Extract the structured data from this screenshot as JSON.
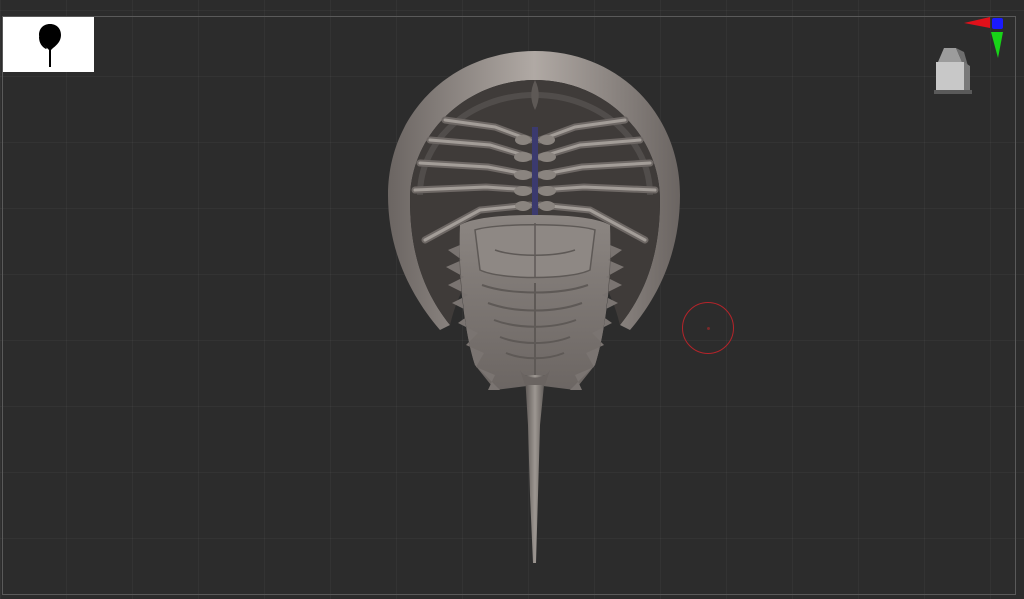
{
  "app": {
    "viewport_background": "#2c2c2c",
    "grid_color": "rgba(255,255,255,0.035)",
    "frame_color": "#5a5a5a"
  },
  "navigator": {
    "icon": "horseshoe-crab-silhouette-icon",
    "background": "#ffffff",
    "silhouette_color": "#000000"
  },
  "axis_gizmo": {
    "icon": "axis-gizmo-icon",
    "x_color": "#e0101a",
    "y_color": "#18d418",
    "z_color": "#1a1aff"
  },
  "view_cube": {
    "icon": "view-cube-icon",
    "face_color": "#c8c8c8"
  },
  "model": {
    "icon": "horseshoe-crab-model",
    "shell_color": "#8f8985",
    "shadow_color": "#3a3634",
    "highlight_color": "#c4bdb8",
    "spine_accent": "#3b3a6e"
  },
  "brush": {
    "icon": "brush-cursor-icon",
    "ring_color": "#b4242a"
  }
}
